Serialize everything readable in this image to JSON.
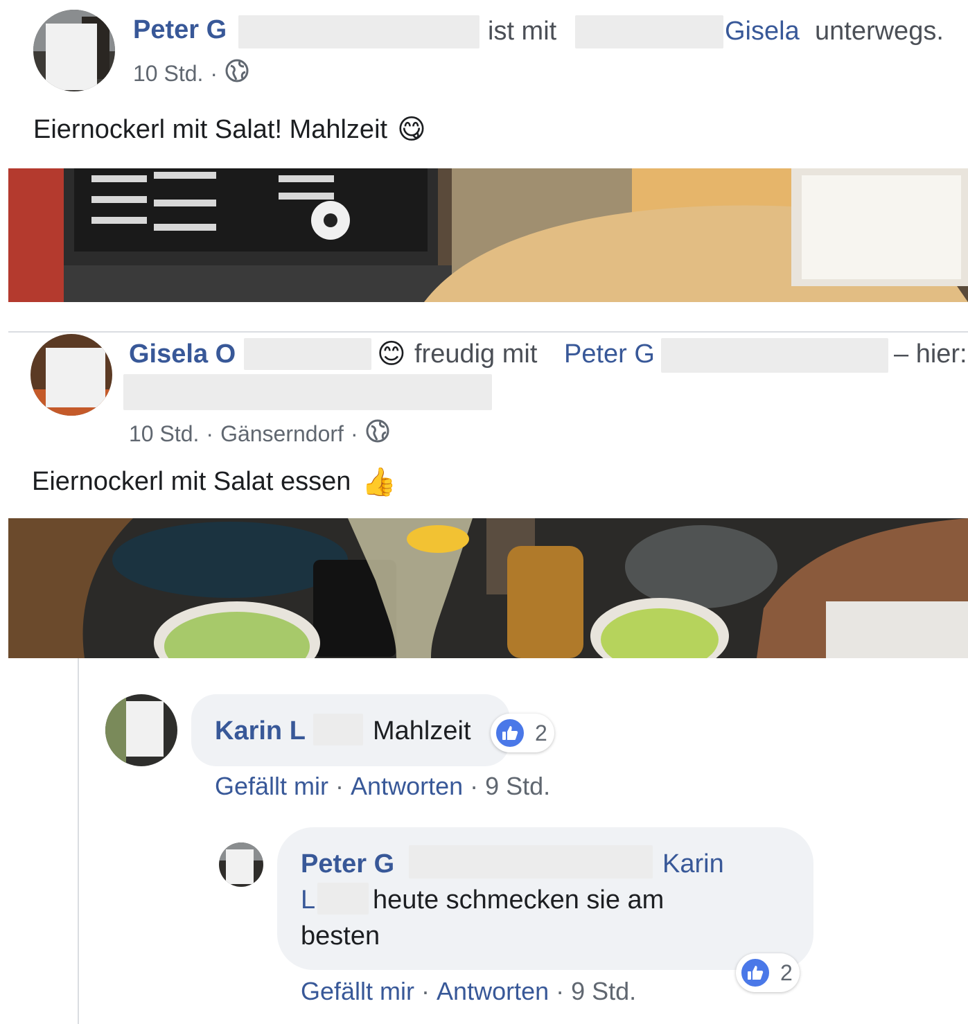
{
  "post1": {
    "author": "Peter G",
    "connector": "ist mit",
    "tagged_name": "Gisela",
    "tagged_suffix": "unterwegs.",
    "time": "10 Std.",
    "dot": "·",
    "privacy_icon": "globe-icon",
    "text": "Eiernockerl mit Salat! Mahlzeit",
    "emoji": "😋"
  },
  "post2": {
    "author": "Gisela O",
    "feeling_emoji": "😊",
    "feeling": "freudig mit",
    "tagged_name": "Peter G",
    "suffix": "– hier:",
    "time": "10 Std.",
    "dot": "·",
    "location": "Gänserndorf",
    "privacy_icon": "globe-icon",
    "text": "Eiernockerl mit Salat essen",
    "emoji": "👍"
  },
  "comments": [
    {
      "author": "Karin L",
      "text": "Mahlzeit",
      "like_count": "2",
      "like_action": "Gefällt mir",
      "reply_action": "Antworten",
      "time": "9 Std.",
      "dot": "·"
    }
  ],
  "reply": {
    "author": "Peter G",
    "mention_first": "Karin",
    "mention_last": "L",
    "text_line1": "heute schmecken sie am",
    "text_line2": "besten",
    "like_count": "2",
    "like_action": "Gefällt mir",
    "reply_action": "Antworten",
    "time": "9 Std.",
    "dot": "·"
  },
  "colors": {
    "link": "#385898",
    "meta_gray": "#606770",
    "bubble": "#f0f2f5",
    "like_blue": "#4a78e8"
  }
}
